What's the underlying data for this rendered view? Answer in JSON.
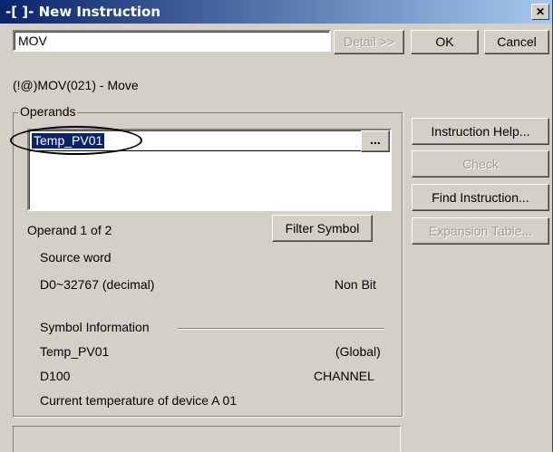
{
  "window": {
    "title": "-[ ]- New Instruction",
    "close_glyph": "✕"
  },
  "instruction_input": {
    "value": "MOV"
  },
  "buttons": {
    "detail": "Detail >>",
    "ok": "OK",
    "cancel": "Cancel",
    "instruction_help": "Instruction Help...",
    "check": "Check",
    "find_instruction": "Find Instruction...",
    "expansion_table": "Expansion Table...",
    "filter_symbol": "Filter Symbol",
    "browse": "..."
  },
  "instruction_desc": "(!@)MOV(021) - Move",
  "operands": {
    "group_label": "Operands",
    "operand_value": "Temp_PV01",
    "position": "Operand 1 of 2",
    "description": "Source word",
    "range": "D0~32767 (decimal)",
    "bit_type": "Non Bit"
  },
  "symbol_info": {
    "label": "Symbol Information",
    "name": "Temp_PV01",
    "scope": "(Global)",
    "address": "D100",
    "data_type": "CHANNEL",
    "comment": "Current temperature of device A 01"
  }
}
